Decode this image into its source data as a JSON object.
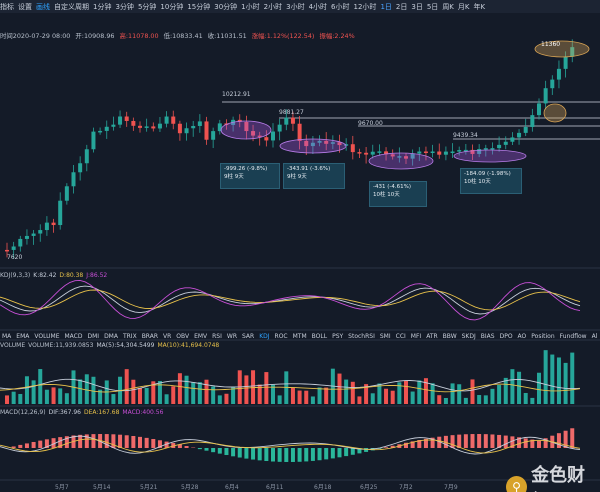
{
  "toolbar": {
    "items": [
      "指标",
      "设置",
      "画线",
      "自定义周期",
      "1分钟",
      "3分钟",
      "5分钟",
      "10分钟",
      "15分钟",
      "30分钟",
      "1小时",
      "2小时",
      "3小时",
      "4小时",
      "6小时",
      "12小时",
      "1日",
      "2日",
      "3日",
      "5日",
      "周K",
      "月K",
      "年K"
    ],
    "active_index": 16
  },
  "info": {
    "time": "时间2020-07-29 08:00",
    "open": "开:10908.96",
    "high": "高:11078.00",
    "low": "低:10833.41",
    "close": "收:11031.51",
    "chg": "涨幅:1.12%(122.54)",
    "amp": "振幅:2.24%"
  },
  "price_labels": {
    "p1": "10212.91",
    "p2": "9881.27",
    "p3": "9670.00",
    "p4": "9439.34",
    "p5": "11360",
    "low": "7620"
  },
  "annotations": [
    {
      "line1": "-999.26 (-9.8%)",
      "line2": "9柱 9天"
    },
    {
      "line1": "-343.91 (-3.6%)",
      "line2": "9柱 9天"
    },
    {
      "line1": "-431 (-4.61%)",
      "line2": "10柱 10天"
    },
    {
      "line1": "-184.09 (-1.98%)",
      "line2": "10柱 10天"
    }
  ],
  "kdj": {
    "name": "KDJ(9,3,3)",
    "k": "K:82.42",
    "d": "D:80.38",
    "j": "J:86.52"
  },
  "indicator_tabs": [
    "MA",
    "EMA",
    "VOLUME",
    "MACD",
    "DMI",
    "DMA",
    "TRIX",
    "BRAR",
    "VR",
    "OBV",
    "EMV",
    "RSI",
    "WR",
    "SAR",
    "KDJ",
    "ROC",
    "MTM",
    "BOLL",
    "PSY",
    "StochRSI",
    "SMI",
    "CCI",
    "MFI",
    "ATR",
    "BBW",
    "SKDJ",
    "BIAS",
    "DPO",
    "AO",
    "Position",
    "Fundflow",
    "Al"
  ],
  "active_tab": "KDJ",
  "volume": {
    "name": "VOLUME",
    "v": "VOLUME:11,939.0853",
    "ma5": "MA(5):54,304.5499",
    "ma10": "MA(10):41,694.0748"
  },
  "macd": {
    "name": "MACD(12,26,9)",
    "dif": "DIF:367.96",
    "dea": "DEA:167.68",
    "macd": "MACD:400.56"
  },
  "xaxis": [
    "5月7",
    "5月14",
    "5月21",
    "5月28",
    "6月4",
    "6月11",
    "6月18",
    "6月25",
    "7月2",
    "7月9"
  ],
  "watermark": "金色财经",
  "colors": {
    "up": "#26a69a",
    "down": "#ef5350",
    "bg": "#141b28"
  }
}
